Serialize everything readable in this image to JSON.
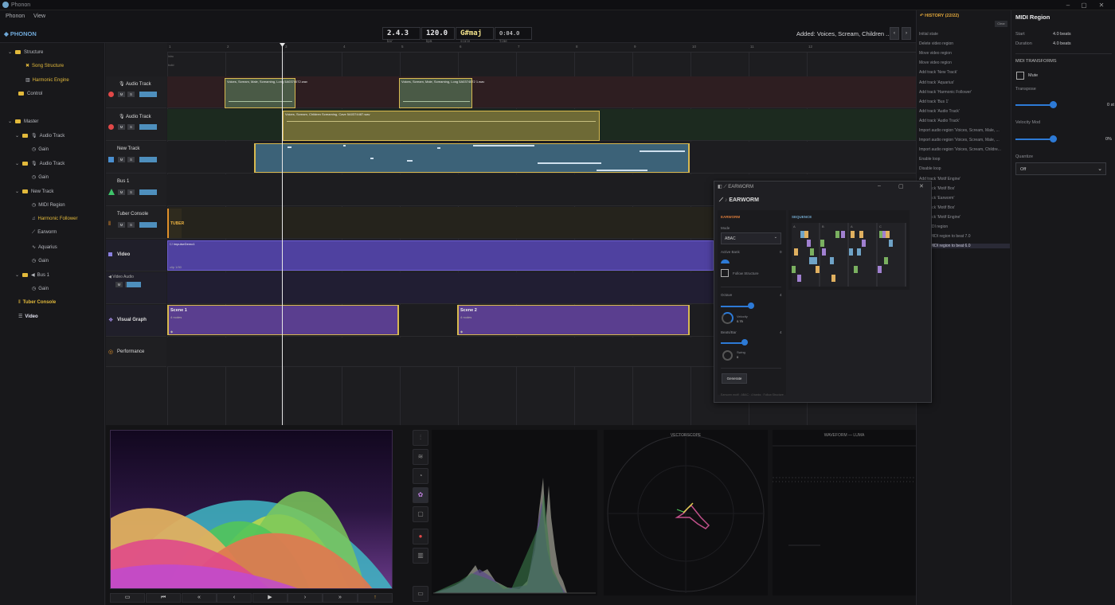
{
  "app": {
    "title": "Phonon",
    "brand": "◆ PHONON"
  },
  "menu": {
    "items": [
      "Phonon",
      "View"
    ]
  },
  "transport": {
    "position": "2.4.3",
    "position_unit": "bar",
    "tempo": "120.0",
    "tempo_unit": "bpm",
    "key": "G#maj",
    "key_unit": "scale",
    "time": "0:04.0",
    "time_unit": "time",
    "status": "Added: Voices, Scream, Children ...",
    "nav_prev": "‹",
    "nav_next": "›"
  },
  "sidebar": {
    "items": [
      {
        "label": "Structure",
        "icon": "folder-icon"
      },
      {
        "label": "Song Structure",
        "icon": "song-structure-icon"
      },
      {
        "label": "Harmonic Engine",
        "icon": "harmonic-engine-icon"
      },
      {
        "label": "Control",
        "icon": "folder-icon"
      },
      {
        "label": "Master",
        "icon": "folder-icon"
      },
      {
        "label": "Audio Track",
        "icon": "folder-icon"
      },
      {
        "label": "Gain",
        "icon": "gain-icon"
      },
      {
        "label": "Audio Track",
        "icon": "folder-icon"
      },
      {
        "label": "Gain",
        "icon": "gain-icon"
      },
      {
        "label": "New Track",
        "icon": "folder-icon"
      },
      {
        "label": "MIDI Region",
        "icon": "midi-region-icon"
      },
      {
        "label": "Harmonic Follower",
        "icon": "harmonic-follower-icon"
      },
      {
        "label": "Earworm",
        "icon": "earworm-icon"
      },
      {
        "label": "Aquarius",
        "icon": "aquarius-icon"
      },
      {
        "label": "Gain",
        "icon": "gain-icon"
      },
      {
        "label": "Bus 1",
        "icon": "folder-icon"
      },
      {
        "label": "Gain",
        "icon": "gain-icon"
      },
      {
        "label": "Tuber Console",
        "icon": "tuber-console-icon"
      },
      {
        "label": "Video",
        "icon": "video-icon"
      }
    ]
  },
  "ruler": {
    "ticks": [
      "1",
      "2",
      "3",
      "4",
      "5",
      "6",
      "7",
      "8",
      "9",
      "10",
      "11",
      "12"
    ],
    "sub1": "intro",
    "sub2": "build"
  },
  "tracks": [
    {
      "name": "Audio Track",
      "m": "M",
      "s": "S",
      "color": "#e04848"
    },
    {
      "name": "Audio Track",
      "m": "M",
      "s": "S",
      "color": "#e04848"
    },
    {
      "name": "New Track",
      "m": "M",
      "s": "S",
      "color": "#4a8fd0"
    },
    {
      "name": "Bus 1",
      "m": "M",
      "s": "S",
      "color": "#3ec46a"
    },
    {
      "name": "Tuber Console",
      "m": "M",
      "s": "S",
      "color": "#e08a2a"
    },
    {
      "name": "Video",
      "m": "",
      "s": "",
      "color": "#6a5ad0"
    },
    {
      "name": "Video Audio",
      "m": "M",
      "s": "S",
      "color": "#6a5ad0"
    },
    {
      "name": "Visual Graph",
      "m": "",
      "s": "",
      "color": "#8a6ae0"
    },
    {
      "name": "Performance",
      "m": "",
      "s": "",
      "color": "#e0902a"
    }
  ],
  "clips": {
    "a1": "Voices, Scream, Male, Screaming, Long 5A0374072.wav",
    "a2": "Voices, Scream, Male, Screaming, Long 5A0374072 1.wav",
    "b1": "Voices, Scream, Children Screaming, Cave 5A0374487.wav",
    "tuber": "TUBER",
    "video": "ImpulseDemo1",
    "video_sub": "clip 1/90",
    "scene1": "Scene 1",
    "scene1_sub": "4 nodes",
    "scene2": "Scene 2",
    "scene2_sub": "4 nodes"
  },
  "history": {
    "title": "HISTORY (22/22)",
    "clear": "Clear",
    "items": [
      "Initial state",
      "Delete video region",
      "Move video region",
      "Move video region",
      "Add track 'New Track'",
      "Add track 'Aquarius'",
      "Add track 'Harmonic Follower'",
      "Add track 'Bus 1'",
      "Add track 'Audio Track'",
      "Add track 'Audio Track'",
      "Import audio region 'Voices, Scream, Male, ...",
      "Import audio region 'Voices, Scream, Male, ...",
      "Import audio region 'Voices, Scream, Childre...",
      "Enable loop",
      "Disable loop",
      "Add track 'Motif Engine'",
      "Add track 'Motif Box'",
      "Add track 'Earworm'",
      "Add track 'Motif Box'",
      "Add track 'Motif Engine'",
      "Add MIDI region",
      "Move MIDI region to beat 7.0",
      "Move MIDI region to beat 6.0"
    ]
  },
  "props": {
    "title": "MIDI Region",
    "start_label": "Start",
    "start_value": "4.0 beats",
    "duration_label": "Duration",
    "duration_value": "4.0 beats",
    "transforms": "MIDI TRANSFORMS",
    "mute": "Mute",
    "transpose": "Transpose",
    "transpose_value": "0 st",
    "velocity": "Velocity Mod",
    "velocity_value": "0%",
    "quantize": "Quantize",
    "quantize_value": "Off"
  },
  "earworm": {
    "window_title": "EARWORM",
    "heading": "EARWORM",
    "panel": "EARWORM",
    "sequence": "SEQUENCE",
    "mode_label": "Mode",
    "mode_value": "ABAC",
    "active_bank_label": "Active Bank",
    "active_bank_value": "0",
    "follow": "Follow Structure",
    "octave_label": "Octave",
    "octave_value": "4",
    "velocity_label": "Velocity",
    "velocity_value": "0.75",
    "beats_label": "Beats/Bar",
    "beats_value": "4",
    "swing_label": "Swing",
    "swing_value": "0",
    "generate": "Generate",
    "footer": "Earworm motif · ABAC · 4 banks · Follow Structure",
    "seq_labels": [
      "A",
      "B",
      "A",
      "C"
    ]
  },
  "scopes": {
    "vectorscope": "VECTORSCOPE",
    "waveform": "WAVEFORM — LUMA"
  },
  "playback": {
    "icons": [
      "film-icon",
      "skip-start-icon",
      "rewind-icon",
      "step-back-icon",
      "play-icon",
      "step-forward-icon",
      "fast-forward-icon",
      "marker-icon"
    ]
  },
  "colors": {
    "accent": "#2d7ad6",
    "history_title": "#e0a63a",
    "earworm_accent": "#d77a3a",
    "sequence_accent": "#6fa3c7"
  }
}
